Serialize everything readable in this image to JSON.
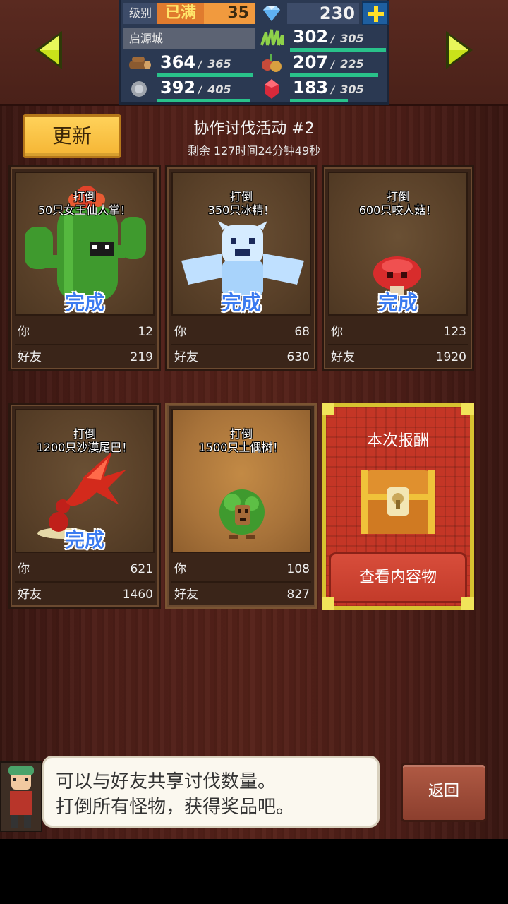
{
  "header": {
    "level_label": "级别",
    "level_max": "已满",
    "level": "35",
    "gems": "230",
    "town": "启源城",
    "resources": [
      {
        "icon": "grass-icon",
        "value": "302",
        "max": "305",
        "fill": 0.99
      },
      {
        "icon": "wood-icon",
        "value": "364",
        "max": "365",
        "fill": 1.0
      },
      {
        "icon": "food-icon",
        "value": "207",
        "max": "225",
        "fill": 0.92
      },
      {
        "icon": "ore-icon",
        "value": "392",
        "max": "405",
        "fill": 0.97
      },
      {
        "icon": "ruby-icon",
        "value": "183",
        "max": "305",
        "fill": 0.6
      }
    ]
  },
  "event": {
    "update_label": "更新",
    "title": "协作讨伐活动 #2",
    "remaining": "剩余 127时间24分钟49秒"
  },
  "labels": {
    "you": "你",
    "friends": "好友",
    "done": "完成"
  },
  "cards": [
    {
      "l1": "打倒",
      "l2": "50只女王仙人掌！",
      "monster": "cactus-queen",
      "done": true,
      "you": "12",
      "friends": "219"
    },
    {
      "l1": "打倒",
      "l2": "350只冰精！",
      "monster": "ice-spirit",
      "done": true,
      "you": "68",
      "friends": "630"
    },
    {
      "l1": "打倒",
      "l2": "600只咬人菇！",
      "monster": "biting-mushroom",
      "done": true,
      "you": "123",
      "friends": "1920"
    },
    {
      "l1": "打倒",
      "l2": "1200只沙漠尾巴！",
      "monster": "desert-tail",
      "done": true,
      "you": "621",
      "friends": "1460"
    },
    {
      "l1": "打倒",
      "l2": "1500只土偶树！",
      "monster": "clay-tree",
      "done": false,
      "you": "108",
      "friends": "827"
    }
  ],
  "reward": {
    "title": "本次报酬",
    "view_label": "查看内容物"
  },
  "dialog": {
    "line1": "可以与好友共享讨伐数量。",
    "line2": "打倒所有怪物，获得奖品吧。",
    "back_label": "返回"
  }
}
